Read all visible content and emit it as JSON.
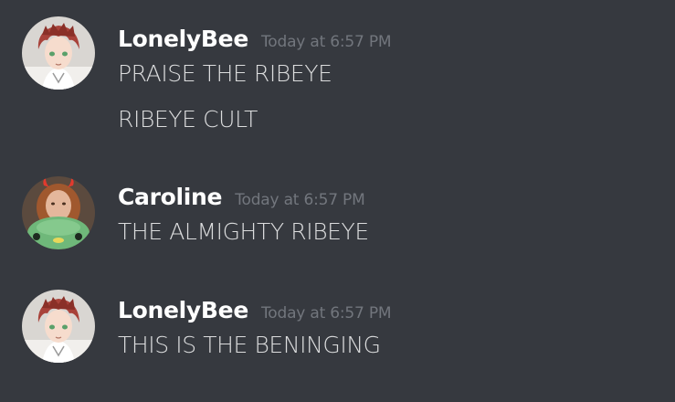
{
  "channel": {
    "messages": [
      {
        "username": "LonelyBee",
        "timestamp": "Today at 6:57 PM",
        "avatar_icon": "anime-boy-red-hair-avatar",
        "lines": [
          "PRAISE THE RIBEYE",
          "RIBEYE CULT"
        ]
      },
      {
        "username": "Caroline",
        "timestamp": "Today at 6:57 PM",
        "avatar_icon": "girl-with-devil-horns-and-green-plush-avatar",
        "lines": [
          "THE ALMIGHTY RIBEYE"
        ]
      },
      {
        "username": "LonelyBee",
        "timestamp": "Today at 6:57 PM",
        "avatar_icon": "anime-boy-red-hair-avatar",
        "lines": [
          "THIS IS THE BENINGING"
        ]
      }
    ]
  },
  "colors": {
    "background": "#36393f",
    "username": "#ffffff",
    "timestamp": "#72767d",
    "message_text": "#dcddde"
  }
}
